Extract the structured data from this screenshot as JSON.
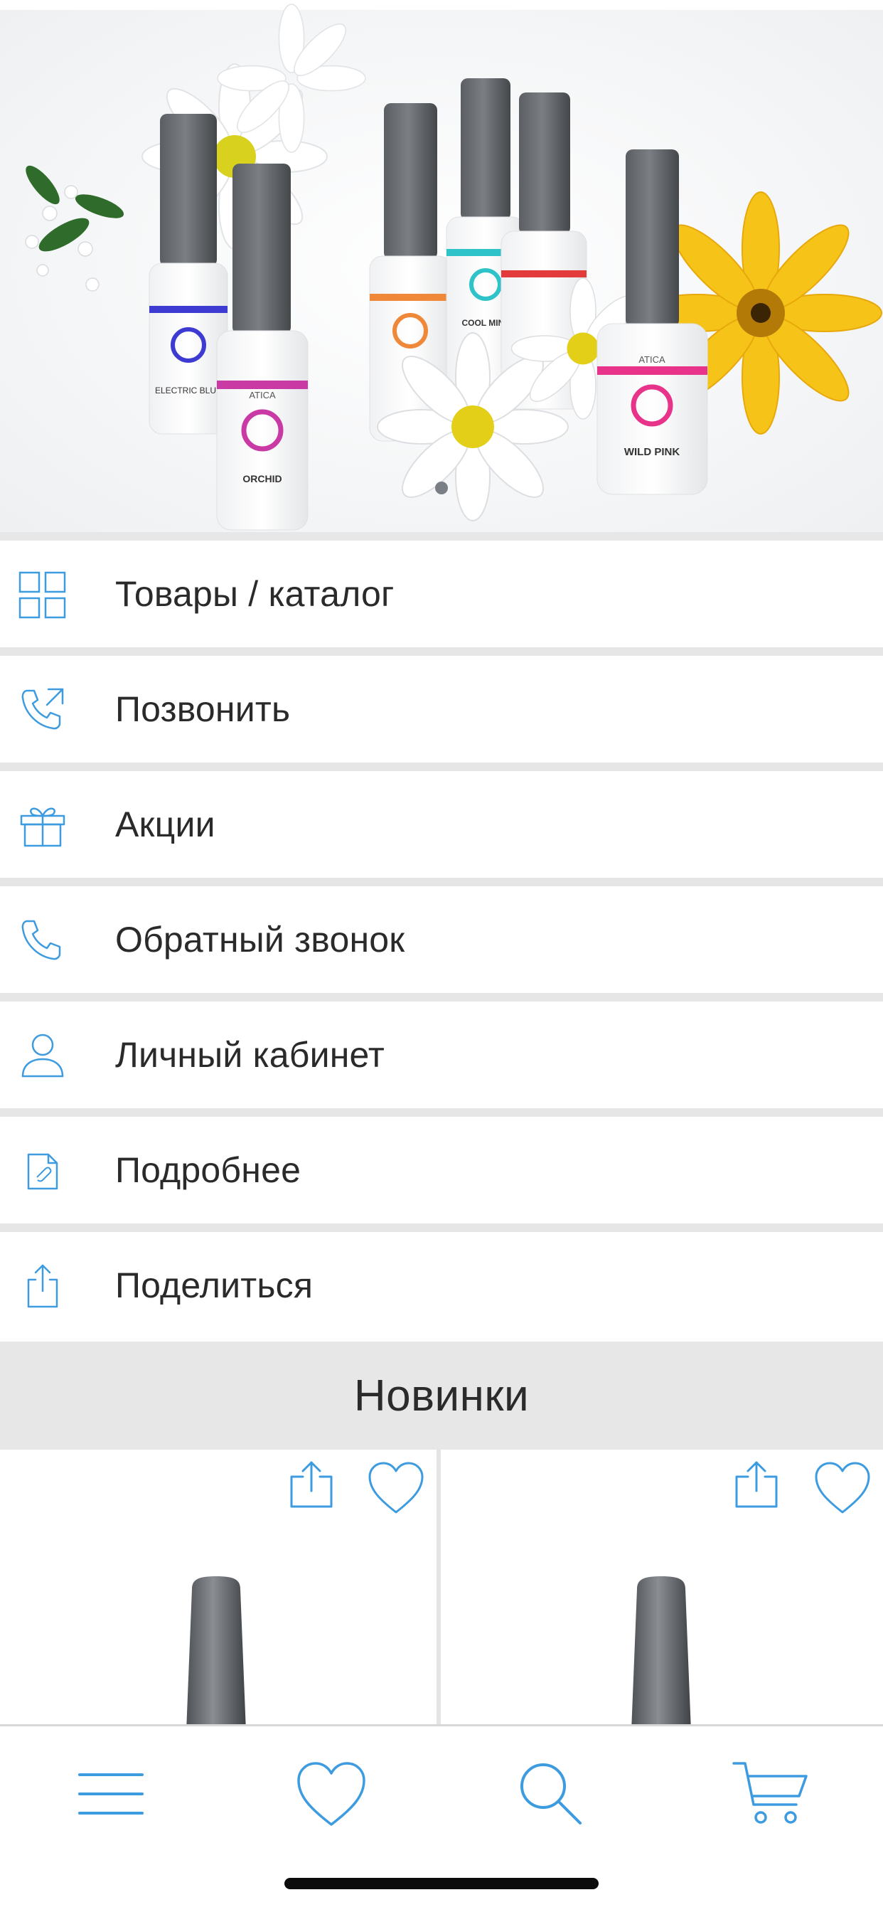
{
  "banner": {
    "bottle_brand": "ATICA",
    "bottles": [
      {
        "name": "ELECTRIC BLUE",
        "color": "#3d3bd1"
      },
      {
        "name": "ORCHID",
        "color": "#c93aa4"
      },
      {
        "name": "COOL MINT",
        "color": "#2ec3c8"
      },
      {
        "name": "WILD PINK",
        "color": "#e8338a"
      }
    ],
    "pager": {
      "count": 1,
      "active": 0
    }
  },
  "menu": {
    "items": [
      {
        "label": "Товары / каталог",
        "icon": "grid-icon"
      },
      {
        "label": "Позвонить",
        "icon": "phone-call-icon"
      },
      {
        "label": "Акции",
        "icon": "gift-icon"
      },
      {
        "label": "Обратный звонок",
        "icon": "phone-icon"
      },
      {
        "label": "Личный кабинет",
        "icon": "user-icon"
      },
      {
        "label": "Подробнее",
        "icon": "document-link-icon"
      },
      {
        "label": "Поделиться",
        "icon": "share-icon"
      }
    ]
  },
  "new_products": {
    "title": "Новинки"
  },
  "tabbar": {
    "items": [
      {
        "icon": "menu-icon"
      },
      {
        "icon": "heart-icon"
      },
      {
        "icon": "search-icon"
      },
      {
        "icon": "cart-icon"
      }
    ]
  },
  "colors": {
    "accent": "#3d9be0",
    "text": "#2a2a2a",
    "divider": "#e6e6e6",
    "section_bg": "#e7e7e7"
  }
}
